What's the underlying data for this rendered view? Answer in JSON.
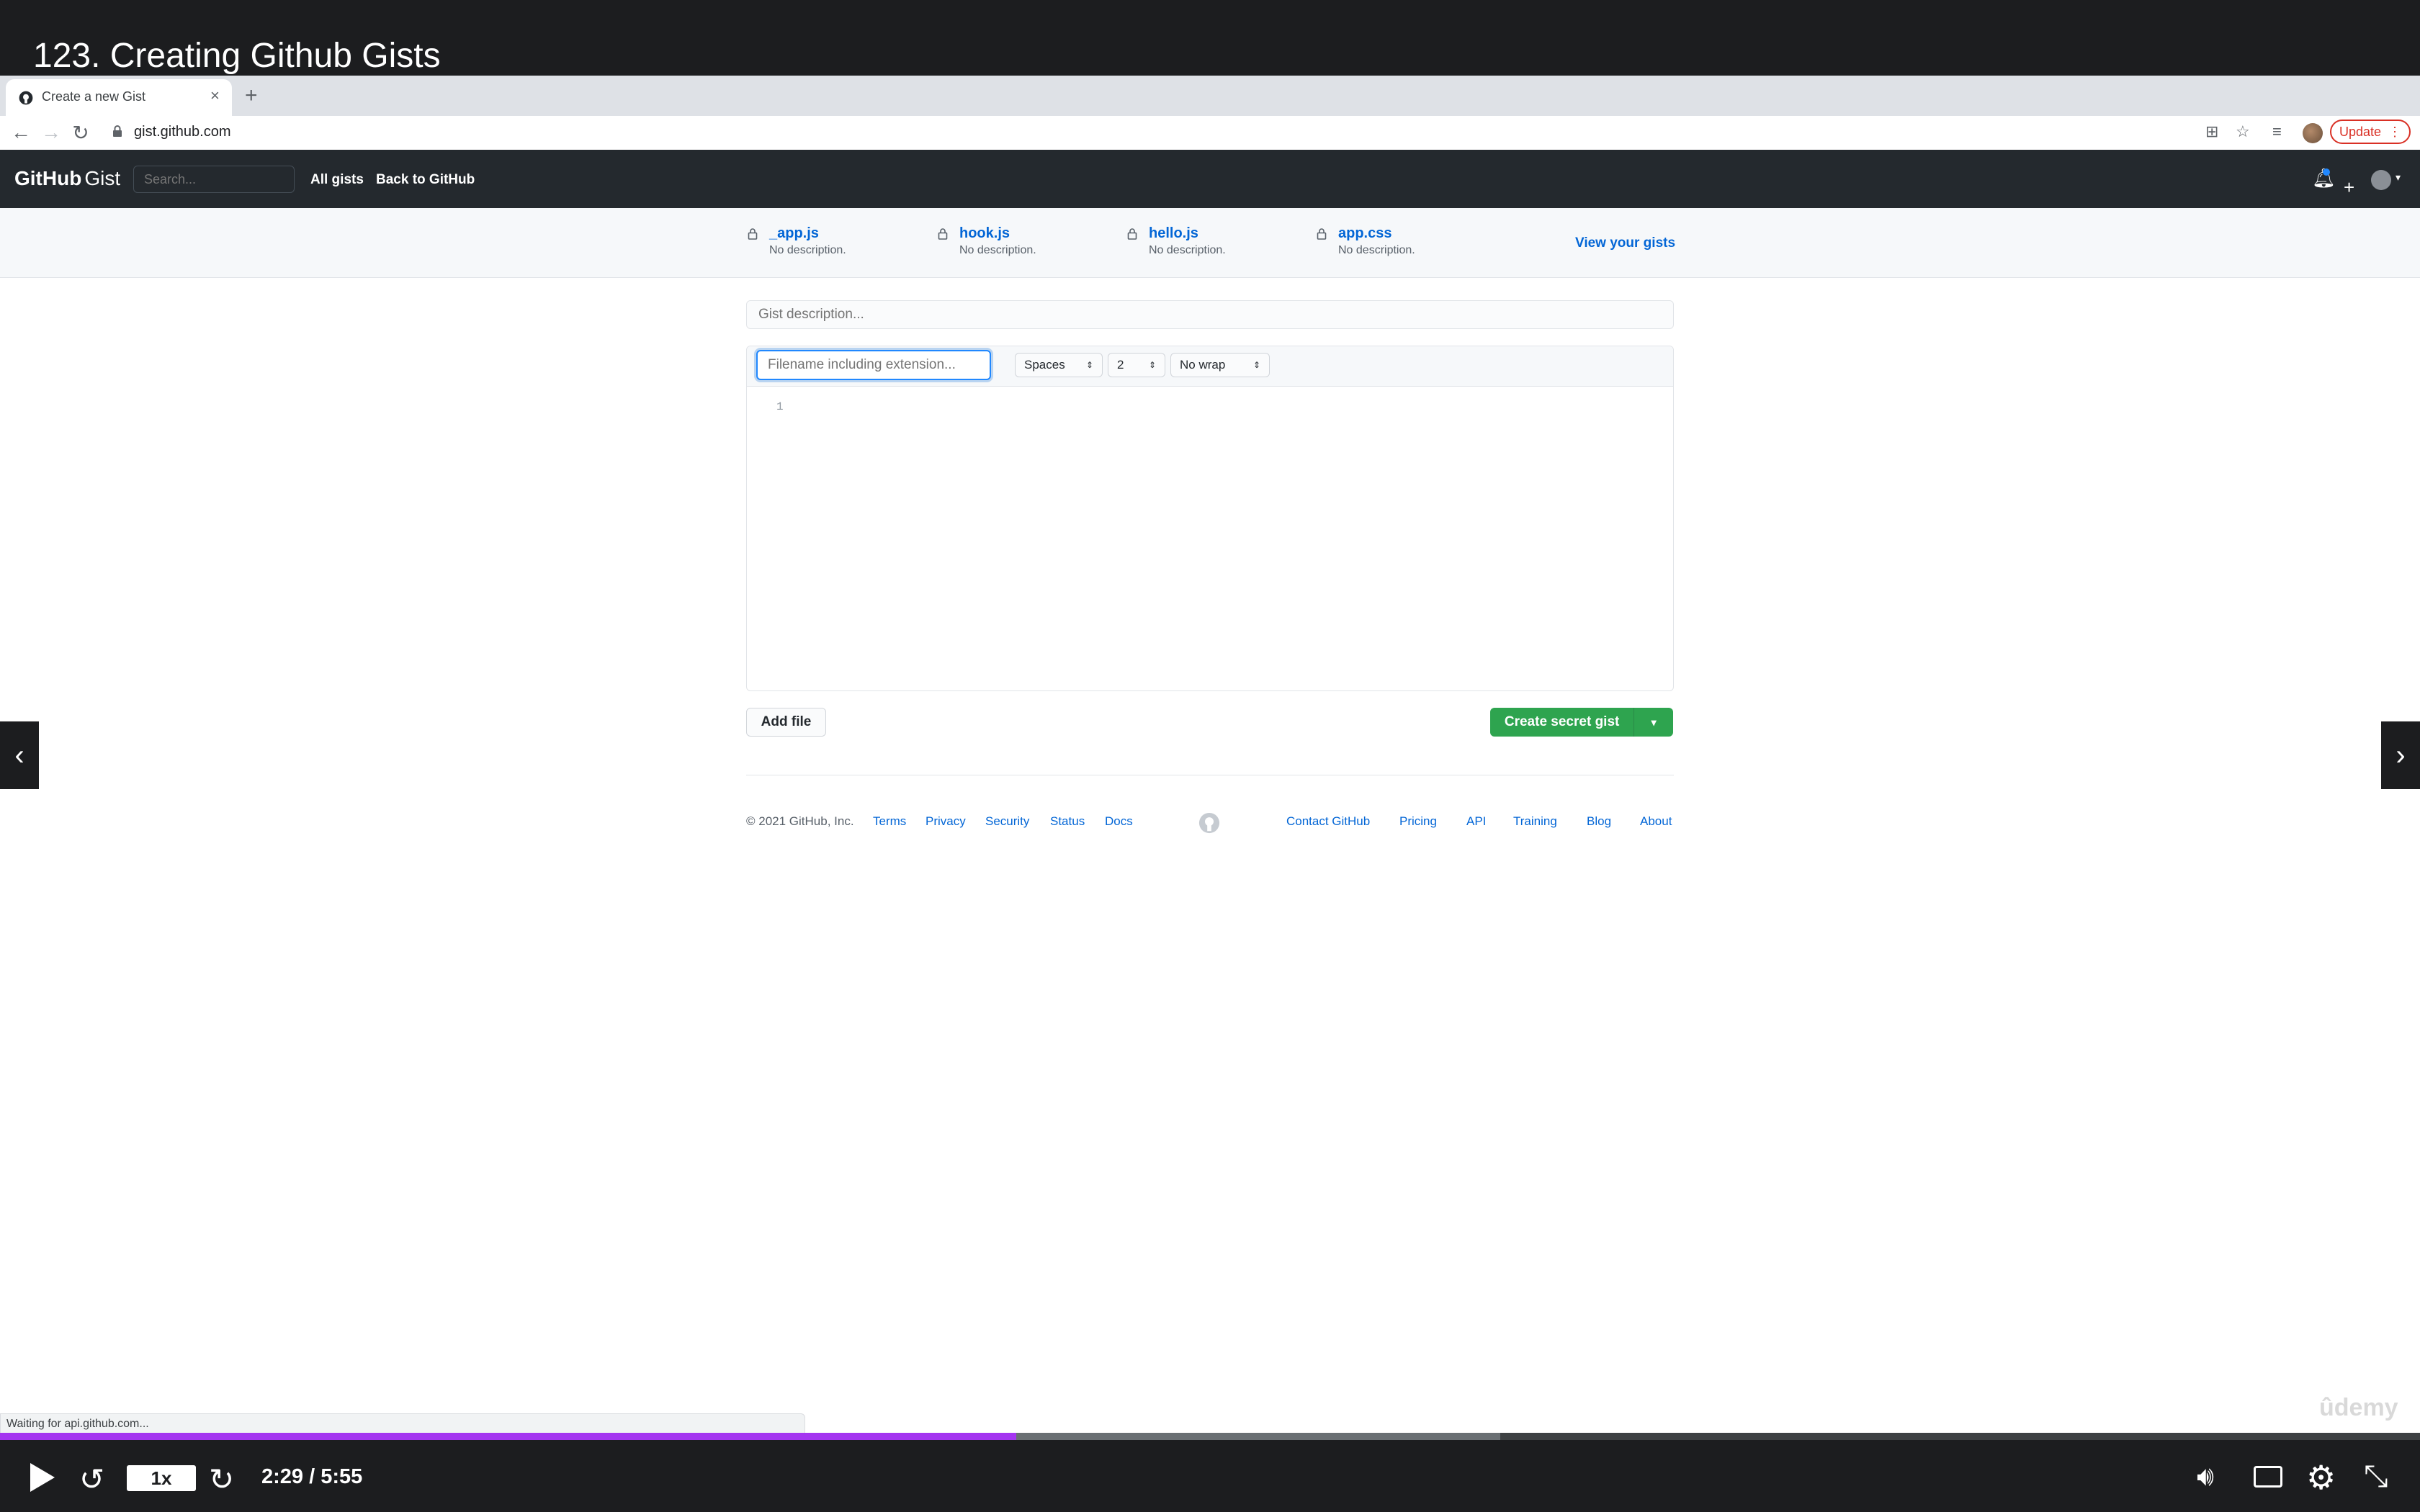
{
  "video": {
    "title": "123. Creating Github Gists",
    "time": "2:29 / 5:55",
    "speed": "1x",
    "progress_fraction": 0.42,
    "buffered_fraction": 0.62,
    "watermark": "ûdemy",
    "prev_glyph": "‹",
    "next_glyph": "›"
  },
  "browser": {
    "tab_title": "Create a new Gist",
    "tab_close": "×",
    "new_tab": "+",
    "url": "gist.github.com",
    "update_label": "Update",
    "update_menu": "⋮",
    "status_text": "Waiting for api.github.com..."
  },
  "header": {
    "logo_text": "GitHub",
    "logo_suffix": "Gist",
    "search_placeholder": "Search...",
    "nav": [
      "All gists",
      "Back to GitHub"
    ]
  },
  "recent_gists": [
    {
      "name": "_app.js",
      "desc": "No description."
    },
    {
      "name": "hook.js",
      "desc": "No description."
    },
    {
      "name": "hello.js",
      "desc": "No description."
    },
    {
      "name": "app.css",
      "desc": "No description."
    }
  ],
  "view_gists_label": "View your gists",
  "editor": {
    "description_placeholder": "Gist description...",
    "filename_placeholder": "Filename including extension...",
    "indent_mode": "Spaces",
    "indent_size": "2",
    "wrap_mode": "No wrap",
    "line_number": "1",
    "add_file_label": "Add file",
    "create_label": "Create secret gist",
    "create_caret": "▾"
  },
  "footer": {
    "copyright": "© 2021 GitHub, Inc.",
    "left_links": [
      "Terms",
      "Privacy",
      "Security",
      "Status",
      "Docs"
    ],
    "right_links": [
      "Contact GitHub",
      "Pricing",
      "API",
      "Training",
      "Blog",
      "About"
    ]
  },
  "colors": {
    "accent": "#a435f0",
    "github_header": "#24292e",
    "primary_button": "#2ea44f",
    "link": "#0366d6"
  }
}
